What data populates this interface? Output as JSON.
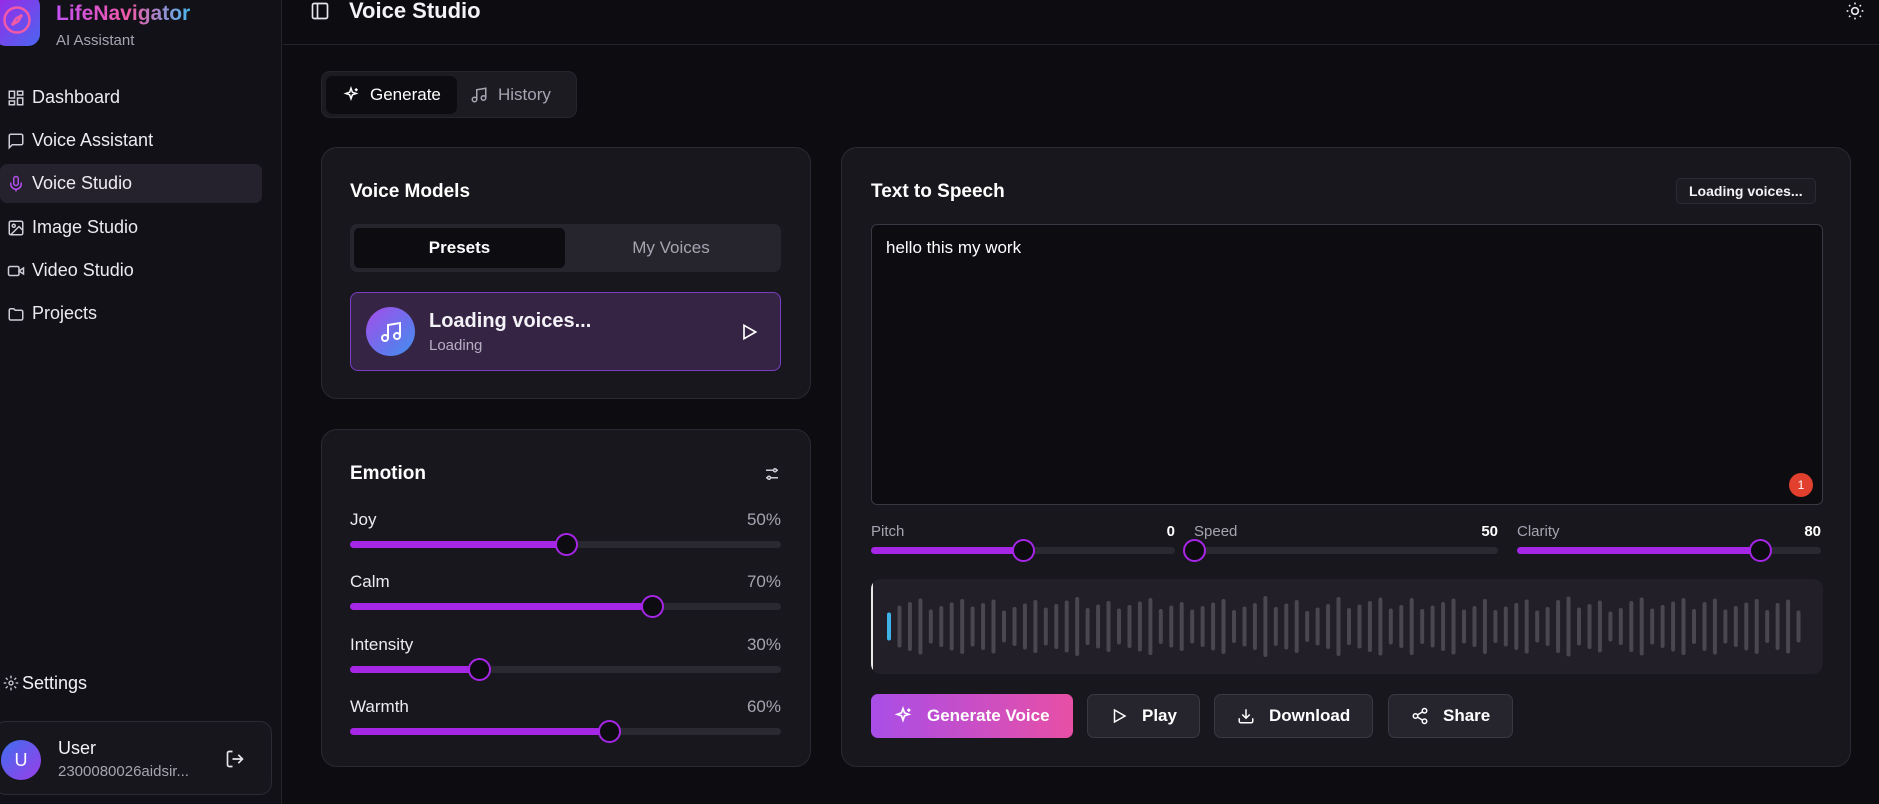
{
  "brand": {
    "name": "LifeNavigator",
    "subtitle": "AI Assistant"
  },
  "sidebar": {
    "items": [
      {
        "label": "Dashboard",
        "icon": "grid-icon"
      },
      {
        "label": "Voice Assistant",
        "icon": "chat-icon"
      },
      {
        "label": "Voice Studio",
        "icon": "mic-icon",
        "active": true
      },
      {
        "label": "Image Studio",
        "icon": "image-icon"
      },
      {
        "label": "Video Studio",
        "icon": "video-icon"
      },
      {
        "label": "Projects",
        "icon": "folder-icon"
      }
    ],
    "settings_label": "Settings",
    "user": {
      "initial": "U",
      "name": "User",
      "email": "2300080026aidsir..."
    }
  },
  "header": {
    "title": "Voice Studio"
  },
  "mode_tabs": {
    "generate": "Generate",
    "history": "History"
  },
  "voice_models": {
    "title": "Voice Models",
    "tabs": {
      "presets": "Presets",
      "my_voices": "My Voices"
    },
    "item": {
      "name": "Loading voices...",
      "status": "Loading"
    }
  },
  "emotion": {
    "title": "Emotion",
    "sliders": [
      {
        "label": "Joy",
        "value": 50,
        "display": "50%"
      },
      {
        "label": "Calm",
        "value": 70,
        "display": "70%"
      },
      {
        "label": "Intensity",
        "value": 30,
        "display": "30%"
      },
      {
        "label": "Warmth",
        "value": 60,
        "display": "60%"
      }
    ]
  },
  "tts": {
    "title": "Text to Speech",
    "badge": "Loading voices...",
    "text": "hello this my work",
    "counter": "1",
    "params": [
      {
        "label": "Pitch",
        "value": 0,
        "display": "0",
        "min": -50,
        "max": 50
      },
      {
        "label": "Speed",
        "value": 50,
        "display": "50",
        "min": 50,
        "max": 200
      },
      {
        "label": "Clarity",
        "value": 80,
        "display": "80",
        "min": 0,
        "max": 100
      }
    ],
    "buttons": {
      "generate": "Generate Voice",
      "play": "Play",
      "download": "Download",
      "share": "Share"
    }
  },
  "colors": {
    "accent": "#a626e6",
    "bg": "#0d0c11",
    "card": "#18171d"
  }
}
